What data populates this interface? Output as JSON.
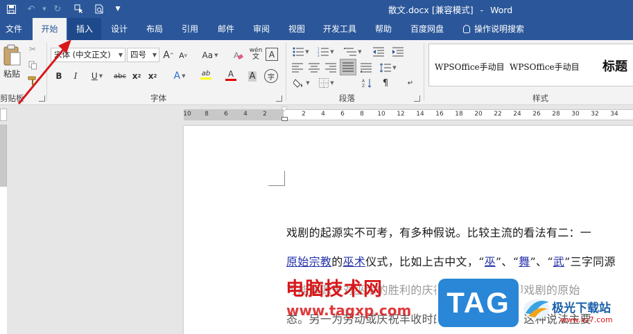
{
  "titlebar": {
    "doc_name": "散文.docx",
    "mode": "[兼容模式]",
    "separator": "-",
    "app_name": "Word",
    "qat": [
      "save-icon",
      "undo-icon",
      "redo-icon",
      "touch-mode-icon",
      "print-preview-icon",
      "customize-qat-icon"
    ]
  },
  "tabs": [
    {
      "label": "文件"
    },
    {
      "label": "开始"
    },
    {
      "label": "插入"
    },
    {
      "label": "设计"
    },
    {
      "label": "布局"
    },
    {
      "label": "引用"
    },
    {
      "label": "邮件"
    },
    {
      "label": "审阅"
    },
    {
      "label": "视图"
    },
    {
      "label": "开发工具"
    },
    {
      "label": "帮助"
    },
    {
      "label": "百度网盘"
    },
    {
      "label": "操作说明搜索"
    }
  ],
  "ribbon": {
    "clipboard": {
      "paste_label": "粘贴",
      "group_label": "剪贴板"
    },
    "font": {
      "font_name": "宋体 (中文正文)",
      "font_size": "四号",
      "group_label": "字体",
      "buttons": {
        "grow": "A",
        "shrink": "A",
        "case": "Aa",
        "phonetic": "wén",
        "bold": "B",
        "italic": "I",
        "underline": "U",
        "strike": "abc",
        "subscript": "x",
        "superscript": "x",
        "effects": "A",
        "highlight": "ab",
        "color": "A",
        "char_border": "A",
        "enclose": "字"
      }
    },
    "paragraph": {
      "group_label": "段落"
    },
    "styles": {
      "group_label": "样式",
      "items": [
        "WPSOffice手动目",
        "WPSOffice手动目",
        "标题"
      ]
    }
  },
  "ruler": {
    "left_ticks": [
      "10",
      "8",
      "6",
      "4",
      "2"
    ],
    "right_ticks": [
      "2",
      "4",
      "6",
      "8",
      "10",
      "12",
      "14",
      "16",
      "18",
      "20",
      "22",
      "24",
      "26",
      "28",
      "30",
      "32",
      "34"
    ]
  },
  "document": {
    "line1": "戏剧的起源实不可考，有多种假说。比较主流的看法有二：一",
    "line2_parts": [
      {
        "text": "原始宗教",
        "link": true
      },
      {
        "text": "的",
        "link": false
      },
      {
        "text": "巫术",
        "link": true
      },
      {
        "text": "仪式，比如上古中文，“",
        "link": false
      },
      {
        "text": "巫",
        "link": true
      },
      {
        "text": "”、“",
        "link": false
      },
      {
        "text": "舞",
        "link": true
      },
      {
        "text": "”、“",
        "link": false
      },
      {
        "text": "武",
        "link": true
      },
      {
        "text": "”三字同源",
        "link": false
      }
    ],
    "line3": "可能起源于对巫术的胜利的庆祝活动的合称，即戏剧的原始",
    "line4": "态。另一为劳动或庆祝丰收时的即兴歌舞表演，这种说法主要"
  },
  "watermark": {
    "text": "电脑技术网",
    "url": "www.tagxp.com",
    "tag": "TAG",
    "site": "极光下载站",
    "site_url": "www.xz7.com"
  },
  "colors": {
    "brand": "#2b579a",
    "link": "#2431a8",
    "annotation": "#d8181b"
  }
}
